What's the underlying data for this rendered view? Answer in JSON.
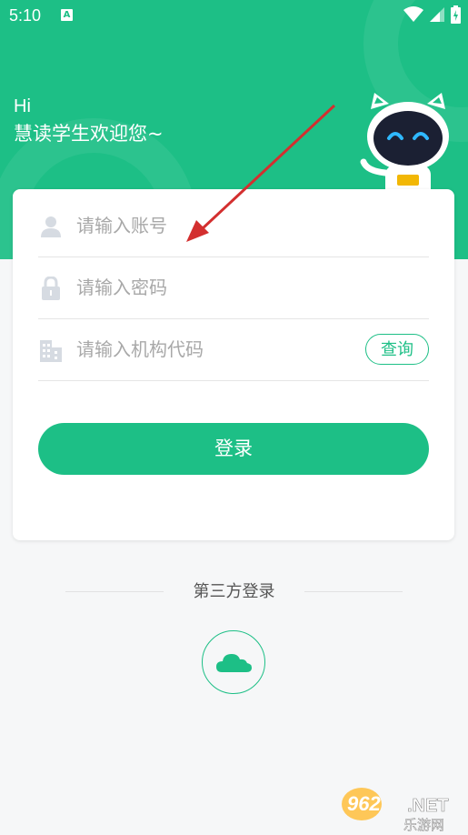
{
  "status_bar": {
    "time": "5:10",
    "notification_badge": "A"
  },
  "greeting": {
    "hi": "Hi",
    "welcome": "慧读学生欢迎您~"
  },
  "form": {
    "account_placeholder": "请输入账号",
    "password_placeholder": "请输入密码",
    "org_placeholder": "请输入机构代码",
    "query_label": "查询",
    "login_label": "登录"
  },
  "third_party": {
    "label": "第三方登录",
    "icon": "cloud-icon"
  },
  "watermark": {
    "number": "962",
    "suffix": ".NET",
    "cn": "乐游网"
  },
  "colors": {
    "primary": "#1dbf86",
    "background": "#f6f7f8",
    "placeholder": "#a8a8a8",
    "arrow": "#d32f2f"
  }
}
